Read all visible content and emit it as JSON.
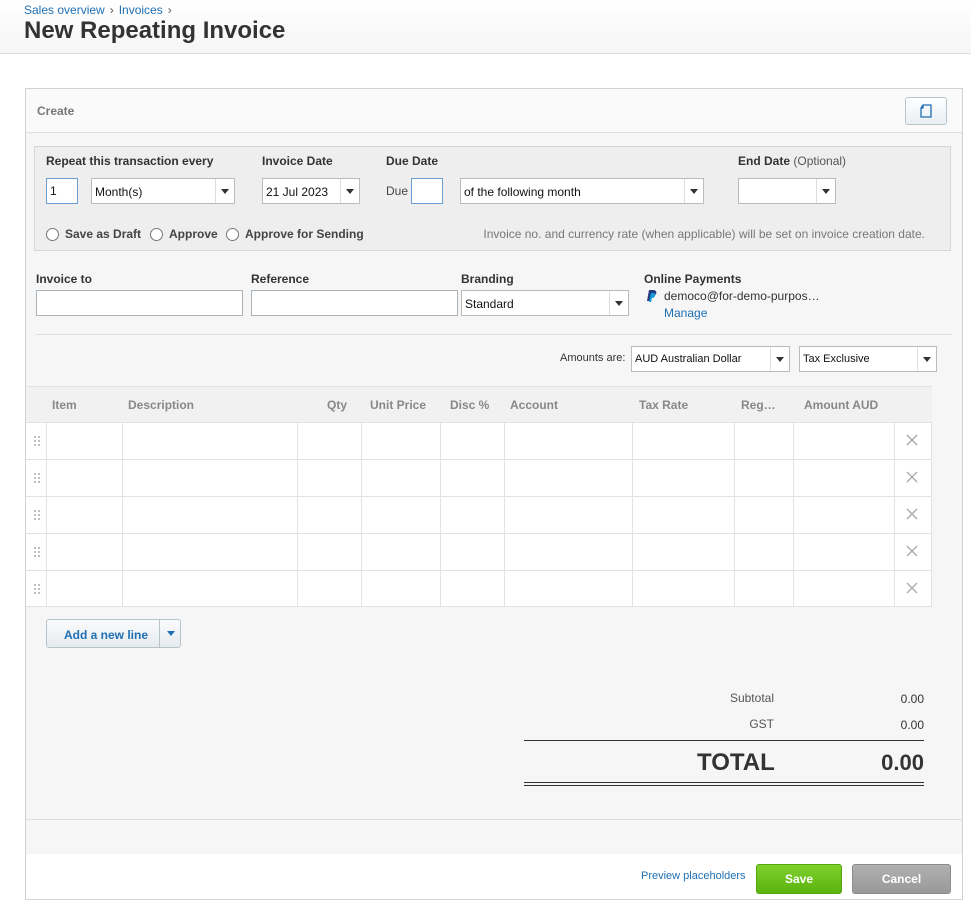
{
  "breadcrumb": {
    "item1": "Sales overview",
    "item2": "Invoices",
    "sep": "›"
  },
  "page_title": "New Repeating Invoice",
  "panel": {
    "create_label": "Create"
  },
  "repeat": {
    "repeat_label": "Repeat this transaction every",
    "repeat_value": "1",
    "period_value": "Month(s)",
    "invoice_date_label": "Invoice Date",
    "invoice_date_value": "21 Jul 2023",
    "due_date_label": "Due Date",
    "due_prefix": "Due",
    "due_value": "",
    "due_terms_value": "of the following month",
    "end_date_label": "End Date",
    "end_date_optional": "(Optional)",
    "end_date_value": "",
    "radio_draft": "Save as Draft",
    "radio_approve": "Approve",
    "radio_approve_sending": "Approve for Sending",
    "note": "Invoice no. and currency rate (when applicable) will be set on invoice creation date."
  },
  "details": {
    "invoice_to_label": "Invoice to",
    "invoice_to_value": "",
    "reference_label": "Reference",
    "reference_value": "",
    "branding_label": "Branding",
    "branding_value": "Standard",
    "online_payments_label": "Online Payments",
    "online_payments_account": "democo@for-demo-purpos…",
    "manage_link": "Manage"
  },
  "amounts": {
    "label": "Amounts are:",
    "currency_value": "AUD Australian Dollar",
    "tax_value": "Tax Exclusive"
  },
  "grid": {
    "headers": [
      "Item",
      "Description",
      "Qty",
      "Unit Price",
      "Disc %",
      "Account",
      "Tax Rate",
      "Reg…",
      "Amount AUD"
    ],
    "rows": 5
  },
  "add_line": {
    "label": "Add a new line"
  },
  "totals": {
    "subtotal_label": "Subtotal",
    "subtotal_value": "0.00",
    "gst_label": "GST",
    "gst_value": "0.00",
    "total_label": "TOTAL",
    "total_value": "0.00"
  },
  "footer": {
    "preview_link": "Preview placeholders",
    "save_label": "Save",
    "cancel_label": "Cancel"
  },
  "colors": {
    "link": "#1f6fb2",
    "save": "#6cc21e",
    "cancel": "#a5a5a5"
  }
}
